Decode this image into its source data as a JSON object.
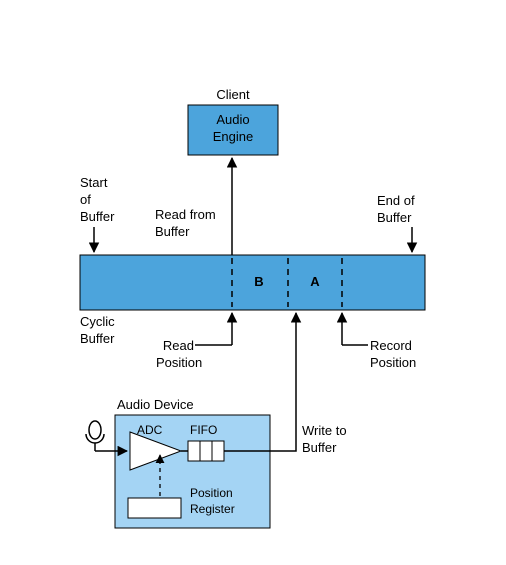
{
  "colors": {
    "fill_dark": "#4ca4dc",
    "fill_light": "#a4d4f4",
    "stroke": "#000000"
  },
  "client": {
    "title": "Client",
    "audio_engine": "Audio\nEngine"
  },
  "buffer": {
    "start_label": "Start\nof\nBuffer",
    "end_label": "End of\nBuffer",
    "read_from": "Read from\nBuffer",
    "cyclic": "Cyclic\nBuffer",
    "read_pos": "Read\nPosition",
    "record_pos": "Record\nPosition",
    "section_b": "B",
    "section_a": "A"
  },
  "device": {
    "title": "Audio Device",
    "adc": "ADC",
    "fifo": "FIFO",
    "pos_reg": "Position\nRegister",
    "write_to": "Write to\nBuffer"
  }
}
